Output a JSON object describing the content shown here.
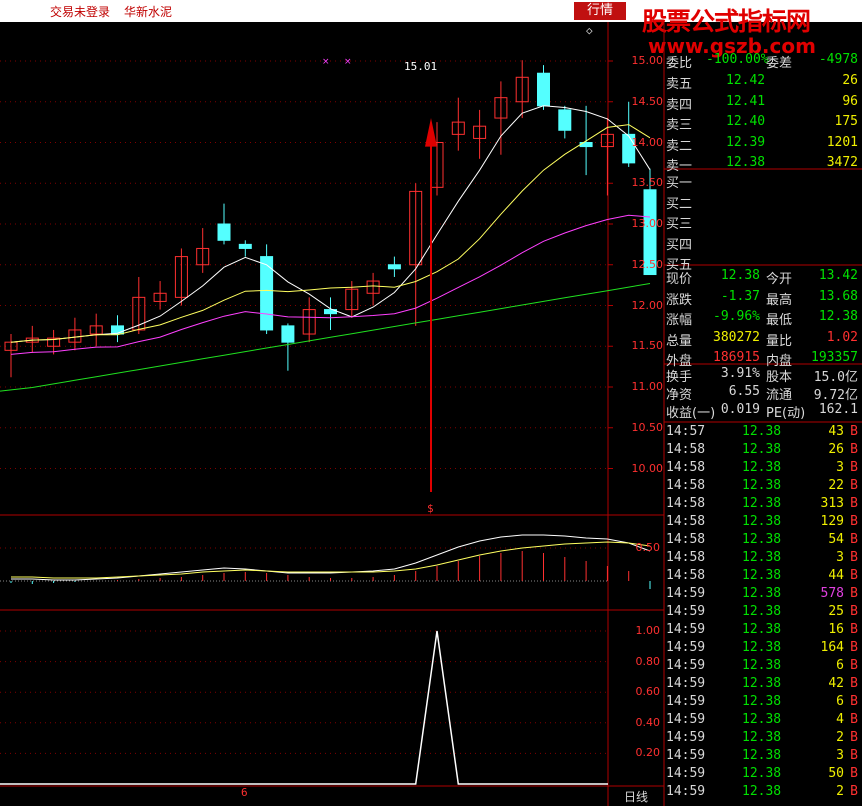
{
  "topbar": {
    "login_status": "交易未登录",
    "stock_name": "华新水泥",
    "quote_button": "行情",
    "logo_title": "股票公式指标网",
    "logo_url": "www.gszb.com"
  },
  "chart": {
    "price_axis": [
      "15.00",
      "14.50",
      "14.00",
      "13.50",
      "13.00",
      "12.50",
      "12.00",
      "11.50",
      "11.00",
      "10.50",
      "10.00"
    ],
    "peak_label": "15.01",
    "signal_label": "$",
    "macd_axis": [
      "0.50"
    ],
    "signal_axis": [
      "1.00",
      "0.80",
      "0.60",
      "0.40",
      "0.20"
    ],
    "x_label": "6",
    "period_label": "日线",
    "candles": [
      {
        "o": 11.45,
        "c": 11.55,
        "h": 11.65,
        "l": 11.12
      },
      {
        "o": 11.55,
        "c": 11.6,
        "h": 11.75,
        "l": 11.42
      },
      {
        "o": 11.5,
        "c": 11.6,
        "h": 11.7,
        "l": 11.4
      },
      {
        "o": 11.55,
        "c": 11.7,
        "h": 11.85,
        "l": 11.45
      },
      {
        "o": 11.65,
        "c": 11.75,
        "h": 11.9,
        "l": 11.5
      },
      {
        "o": 11.75,
        "c": 11.65,
        "h": 11.88,
        "l": 11.55
      },
      {
        "o": 11.7,
        "c": 12.1,
        "h": 12.35,
        "l": 11.65
      },
      {
        "o": 12.05,
        "c": 12.15,
        "h": 12.3,
        "l": 11.95
      },
      {
        "o": 12.1,
        "c": 12.6,
        "h": 12.7,
        "l": 12.0
      },
      {
        "o": 12.5,
        "c": 12.7,
        "h": 12.95,
        "l": 12.4
      },
      {
        "o": 13.0,
        "c": 12.8,
        "h": 13.25,
        "l": 12.75
      },
      {
        "o": 12.75,
        "c": 12.7,
        "h": 12.8,
        "l": 12.6
      },
      {
        "o": 12.6,
        "c": 11.7,
        "h": 12.75,
        "l": 11.65
      },
      {
        "o": 11.75,
        "c": 11.55,
        "h": 11.78,
        "l": 11.2
      },
      {
        "o": 11.65,
        "c": 11.95,
        "h": 12.1,
        "l": 11.55
      },
      {
        "o": 11.95,
        "c": 11.9,
        "h": 12.1,
        "l": 11.7
      },
      {
        "o": 11.95,
        "c": 12.2,
        "h": 12.3,
        "l": 11.85
      },
      {
        "o": 12.15,
        "c": 12.3,
        "h": 12.4,
        "l": 12.0
      },
      {
        "o": 12.5,
        "c": 12.45,
        "h": 12.6,
        "l": 12.35
      },
      {
        "o": 12.5,
        "c": 13.4,
        "h": 13.5,
        "l": 11.75
      },
      {
        "o": 13.45,
        "c": 14.0,
        "h": 14.25,
        "l": 13.35
      },
      {
        "o": 14.1,
        "c": 14.25,
        "h": 14.55,
        "l": 13.9
      },
      {
        "o": 14.05,
        "c": 14.2,
        "h": 14.4,
        "l": 13.8
      },
      {
        "o": 14.3,
        "c": 14.55,
        "h": 14.75,
        "l": 13.85
      },
      {
        "o": 14.5,
        "c": 14.8,
        "h": 15.01,
        "l": 14.3
      },
      {
        "o": 14.85,
        "c": 14.45,
        "h": 14.95,
        "l": 14.4
      },
      {
        "o": 14.4,
        "c": 14.15,
        "h": 14.45,
        "l": 14.05
      },
      {
        "o": 14.0,
        "c": 13.95,
        "h": 14.45,
        "l": 13.6
      },
      {
        "o": 13.95,
        "c": 14.1,
        "h": 14.3,
        "l": 13.35
      },
      {
        "o": 14.1,
        "c": 13.75,
        "h": 14.5,
        "l": 13.7
      },
      {
        "o": 13.42,
        "c": 12.38,
        "h": 13.68,
        "l": 12.38
      }
    ]
  },
  "quote": {
    "ratio_row": {
      "label": "委比",
      "value": "-100.00%",
      "label2": "委差",
      "value2": "-4978"
    },
    "asks": [
      {
        "label": "卖五",
        "price": "12.42",
        "vol": "26"
      },
      {
        "label": "卖四",
        "price": "12.41",
        "vol": "96"
      },
      {
        "label": "卖三",
        "price": "12.40",
        "vol": "175"
      },
      {
        "label": "卖二",
        "price": "12.39",
        "vol": "1201"
      },
      {
        "label": "卖一",
        "price": "12.38",
        "vol": "3472"
      }
    ],
    "bids": [
      {
        "label": "买一"
      },
      {
        "label": "买二"
      },
      {
        "label": "买三"
      },
      {
        "label": "买四"
      },
      {
        "label": "买五"
      }
    ],
    "stats": [
      {
        "l1": "现价",
        "v1": "12.38",
        "l2": "今开",
        "v2": "13.42",
        "c1": "#00e000",
        "c2": "#00e000"
      },
      {
        "l1": "涨跌",
        "v1": "-1.37",
        "l2": "最高",
        "v2": "13.68",
        "c1": "#00e000",
        "c2": "#00e000"
      },
      {
        "l1": "涨幅",
        "v1": "-9.96%",
        "l2": "最低",
        "v2": "12.38",
        "c1": "#00e000",
        "c2": "#00e000"
      },
      {
        "l1": "总量",
        "v1": "380272",
        "l2": "量比",
        "v2": "1.02",
        "c1": "#f0f000",
        "c2": "#ff3030"
      },
      {
        "l1": "外盘",
        "v1": "186915",
        "l2": "内盘",
        "v2": "193357",
        "c1": "#ff3030",
        "c2": "#00e000"
      }
    ],
    "fundamentals": [
      {
        "l1": "换手",
        "v1": "3.91%",
        "l2": "股本",
        "v2": "15.0亿"
      },
      {
        "l1": "净资",
        "v1": "6.55",
        "l2": "流通",
        "v2": "9.72亿"
      },
      {
        "l1": "收益(一)",
        "v1": "0.019",
        "l2": "PE(动)",
        "v2": "162.1"
      }
    ],
    "ticks": [
      {
        "t": "14:57",
        "p": "12.38",
        "v": "43",
        "s": "B"
      },
      {
        "t": "14:58",
        "p": "12.38",
        "v": "26",
        "s": "B"
      },
      {
        "t": "14:58",
        "p": "12.38",
        "v": "3",
        "s": "B"
      },
      {
        "t": "14:58",
        "p": "12.38",
        "v": "22",
        "s": "B"
      },
      {
        "t": "14:58",
        "p": "12.38",
        "v": "313",
        "s": "B"
      },
      {
        "t": "14:58",
        "p": "12.38",
        "v": "129",
        "s": "B"
      },
      {
        "t": "14:58",
        "p": "12.38",
        "v": "54",
        "s": "B"
      },
      {
        "t": "14:58",
        "p": "12.38",
        "v": "3",
        "s": "B"
      },
      {
        "t": "14:58",
        "p": "12.38",
        "v": "44",
        "s": "B"
      },
      {
        "t": "14:59",
        "p": "12.38",
        "v": "578",
        "s": "B"
      },
      {
        "t": "14:59",
        "p": "12.38",
        "v": "25",
        "s": "B"
      },
      {
        "t": "14:59",
        "p": "12.38",
        "v": "16",
        "s": "B"
      },
      {
        "t": "14:59",
        "p": "12.38",
        "v": "164",
        "s": "B"
      },
      {
        "t": "14:59",
        "p": "12.38",
        "v": "6",
        "s": "B"
      },
      {
        "t": "14:59",
        "p": "12.38",
        "v": "42",
        "s": "B"
      },
      {
        "t": "14:59",
        "p": "12.38",
        "v": "6",
        "s": "B"
      },
      {
        "t": "14:59",
        "p": "12.38",
        "v": "4",
        "s": "B"
      },
      {
        "t": "14:59",
        "p": "12.38",
        "v": "2",
        "s": "B"
      },
      {
        "t": "14:59",
        "p": "12.38",
        "v": "3",
        "s": "B"
      },
      {
        "t": "14:59",
        "p": "12.38",
        "v": "50",
        "s": "B"
      },
      {
        "t": "14:59",
        "p": "12.38",
        "v": "2",
        "s": "B"
      }
    ]
  }
}
